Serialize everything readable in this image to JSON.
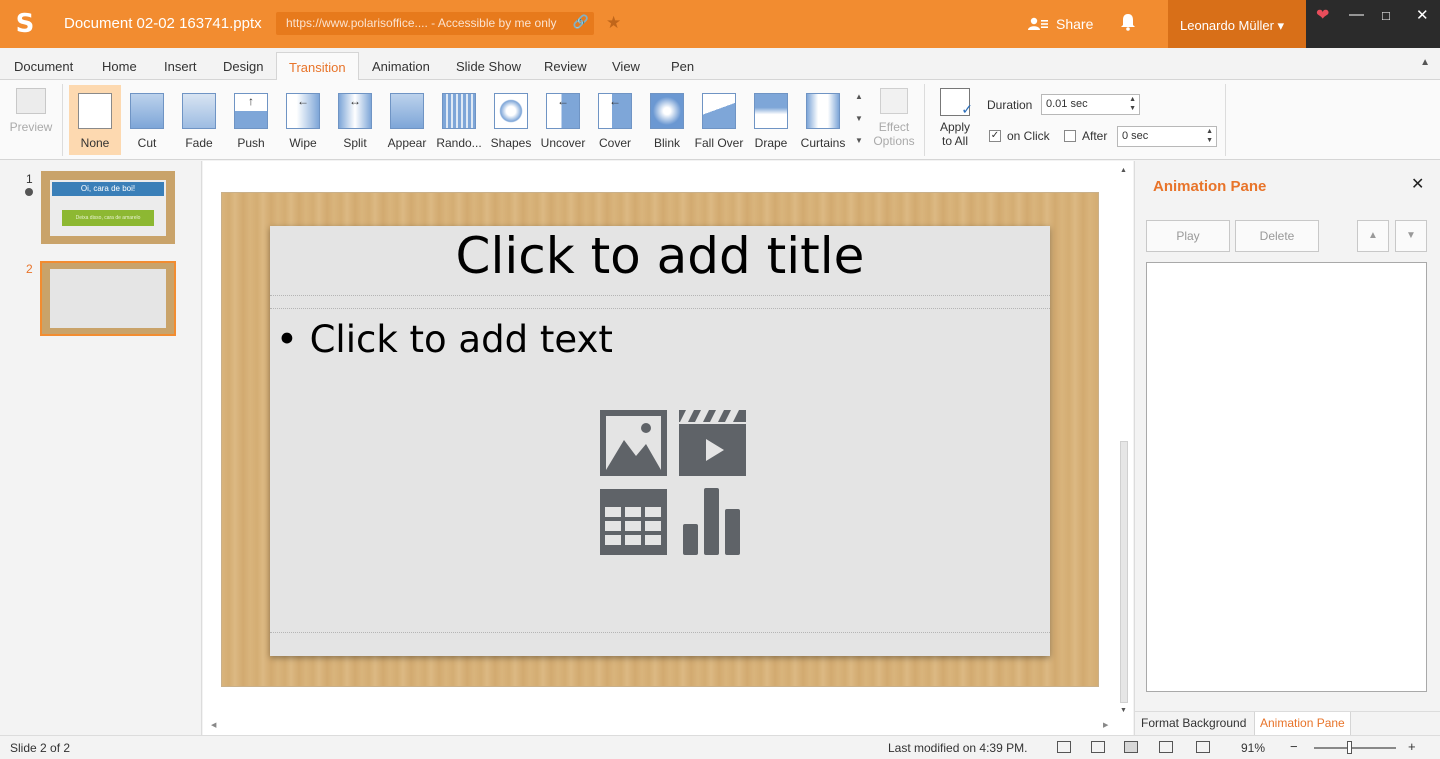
{
  "titlebar": {
    "logo": "S",
    "document_title": "Document 02-02 163741.pptx",
    "url": "https://www.polarisoffice.... - Accessible by me only",
    "share_label": "Share",
    "user_name": "Leonardo Müller ▾"
  },
  "tabs": [
    "Document",
    "Home",
    "Insert",
    "Design",
    "Transition",
    "Animation",
    "Slide Show",
    "Review",
    "View",
    "Pen"
  ],
  "active_tab": "Transition",
  "ribbon": {
    "preview_label": "Preview",
    "transitions": [
      "None",
      "Cut",
      "Fade",
      "Push",
      "Wipe",
      "Split",
      "Appear",
      "Rando...",
      "Shapes",
      "Uncover",
      "Cover",
      "Blink",
      "Fall Over",
      "Drape",
      "Curtains"
    ],
    "selected_transition": "None",
    "effect_options_line1": "Effect",
    "effect_options_line2": "Options",
    "apply_all_line1": "Apply",
    "apply_all_line2": "to All",
    "duration_label": "Duration",
    "duration_value": "0.01 sec",
    "on_click_label": "on Click",
    "on_click_checked": true,
    "after_label": "After",
    "after_checked": false,
    "after_value": "0 sec"
  },
  "thumbnails": {
    "items": [
      {
        "number": "1",
        "title_text": "Oi, cara de boi!",
        "subtitle_text": "Deixa disso, cara de amarelo"
      },
      {
        "number": "2"
      }
    ],
    "selected": 2
  },
  "slide": {
    "title_placeholder": "Click to add title",
    "text_placeholder": "• Click to add text"
  },
  "animation_pane": {
    "title": "Animation Pane",
    "play_label": "Play",
    "delete_label": "Delete",
    "up_label": "▲",
    "down_label": "▼",
    "tab_format_background": "Format Background",
    "tab_animation_pane": "Animation Pane"
  },
  "statusbar": {
    "slide_info": "Slide 2 of 2",
    "last_modified": "Last modified on 4:39 PM.",
    "zoom": "91%",
    "zoom_level": 0.91
  },
  "colors": {
    "brand_orange": "#f28c30",
    "accent_text": "#e8742a",
    "selected_bg": "#fdd9b0"
  }
}
